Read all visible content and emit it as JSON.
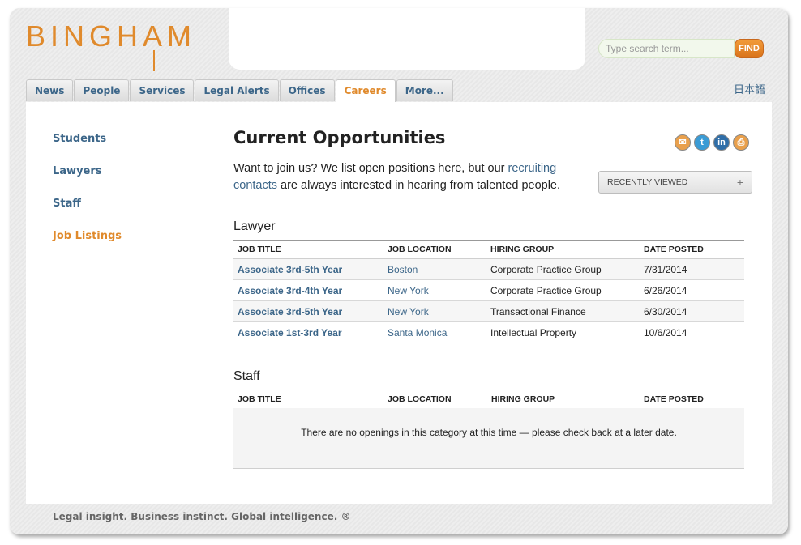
{
  "brand": {
    "logo_text": "BINGHAM",
    "accent": "#e08a2c",
    "link": "#3c6689"
  },
  "search": {
    "placeholder": "Type search term...",
    "button_label": "FIND"
  },
  "nav": {
    "tabs": [
      {
        "label": "News"
      },
      {
        "label": "People"
      },
      {
        "label": "Services"
      },
      {
        "label": "Legal Alerts"
      },
      {
        "label": "Offices"
      },
      {
        "label": "Careers",
        "active": true
      },
      {
        "label": "More..."
      }
    ],
    "language_link": "日本語"
  },
  "sidebar": {
    "items": [
      {
        "label": "Students"
      },
      {
        "label": "Lawyers"
      },
      {
        "label": "Staff"
      },
      {
        "label": "Job Listings",
        "active": true
      }
    ]
  },
  "main": {
    "title": "Current Opportunities",
    "intro_before": "Want to join us? We list open positions here, but our ",
    "intro_link": "recruiting contacts",
    "intro_after": " are always interested in hearing from talented people.",
    "share_icons": [
      "email-icon",
      "twitter-icon",
      "linkedin-icon",
      "print-icon"
    ],
    "recently_viewed": {
      "label": "RECENTLY VIEWED",
      "toggle": "+"
    }
  },
  "columns": [
    "JOB TITLE",
    "JOB LOCATION",
    "HIRING GROUP",
    "DATE POSTED"
  ],
  "lawyer": {
    "heading": "Lawyer",
    "rows": [
      [
        "Associate 3rd-5th Year",
        "Boston",
        "Corporate Practice Group",
        "7/31/2014"
      ],
      [
        "Associate 3rd-4th Year",
        "New York",
        "Corporate Practice Group",
        "6/26/2014"
      ],
      [
        "Associate 3rd-5th Year",
        "New York",
        "Transactional Finance",
        "6/30/2014"
      ],
      [
        "Associate 1st-3rd Year",
        "Santa Monica",
        "Intellectual Property",
        "10/6/2014"
      ]
    ]
  },
  "staff": {
    "heading": "Staff",
    "empty_message": "There are no openings in this category at this time — please check back at a later date."
  },
  "footer": {
    "tagline": "Legal insight. Business instinct. Global intelligence. ®"
  }
}
